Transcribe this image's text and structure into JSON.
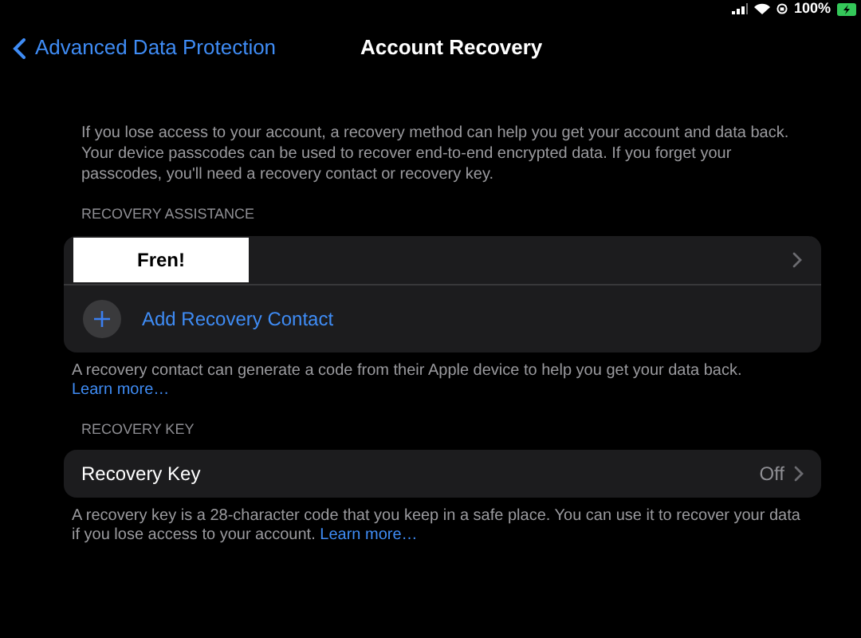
{
  "status_bar": {
    "battery": "100%"
  },
  "nav": {
    "back": "Advanced Data Protection",
    "title": "Account Recovery"
  },
  "intro": "If you lose access to your account, a recovery method can help you get your account and data back. Your device passcodes can be used to recover end-to-end encrypted data. If you forget your passcodes, you'll need a recovery contact or recovery key.",
  "sections": [
    {
      "header": "RECOVERY ASSISTANCE",
      "rows": [
        {
          "kind": "contact",
          "label": "Fren!"
        },
        {
          "kind": "add",
          "label": "Add Recovery Contact"
        }
      ],
      "footer": "A recovery contact can generate a code from their Apple device to help you get your data back.",
      "link": "Learn more…"
    },
    {
      "header": "RECOVERY KEY",
      "rows": [
        {
          "kind": "value",
          "label": "Recovery Key",
          "value": "Off"
        }
      ],
      "footer": "A recovery key is a 28-character code that you keep in a safe place. You can use it to recover your data if you lose access to your account.",
      "link": "Learn more…"
    }
  ]
}
